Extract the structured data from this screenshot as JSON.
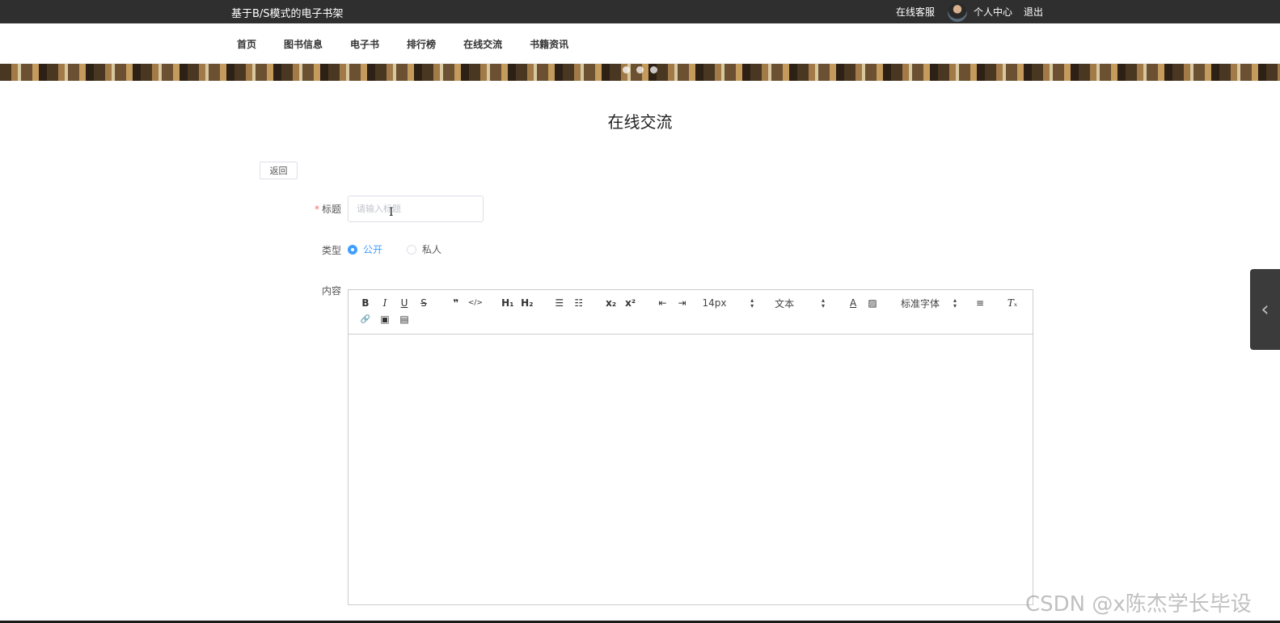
{
  "header": {
    "site_title": "基于B/S模式的电子书架",
    "service_label": "在线客服",
    "profile_label": "个人中心",
    "logout_label": "退出"
  },
  "nav": {
    "items": [
      "首页",
      "图书信息",
      "电子书",
      "排行榜",
      "在线交流",
      "书籍资讯"
    ]
  },
  "page": {
    "title": "在线交流",
    "back_label": "返回"
  },
  "form": {
    "title_label": "标题",
    "title_required_mark": "*",
    "title_value": "",
    "title_placeholder": "请输入标题",
    "type_label": "类型",
    "type_options": [
      "公开",
      "私人"
    ],
    "type_selected": "公开",
    "content_label": "内容"
  },
  "editor": {
    "tools": {
      "bold": "B",
      "italic": "I",
      "underline": "U",
      "strike": "S",
      "quote": "❞",
      "code": "</>",
      "h1": "H₁",
      "h2": "H₂",
      "ordered_list": "☰",
      "bullet_list": "☷",
      "subscript": "x₂",
      "superscript": "x²",
      "indent_left": "⇤",
      "indent_right": "⇥",
      "color": "A",
      "background": "▨",
      "align": "≡",
      "clean": "Tₓ",
      "link": "🔗",
      "image": "▣",
      "video": "▤"
    },
    "font_size": "14px",
    "header_select": "文本",
    "font_family": "标准字体",
    "content": ""
  },
  "side_tab_icon": "chevron-left-icon",
  "watermark": "CSDN @x陈杰学长毕设",
  "colors": {
    "topbar": "#2f2f2f",
    "accent": "#409eff",
    "required": "#f56c6c"
  }
}
